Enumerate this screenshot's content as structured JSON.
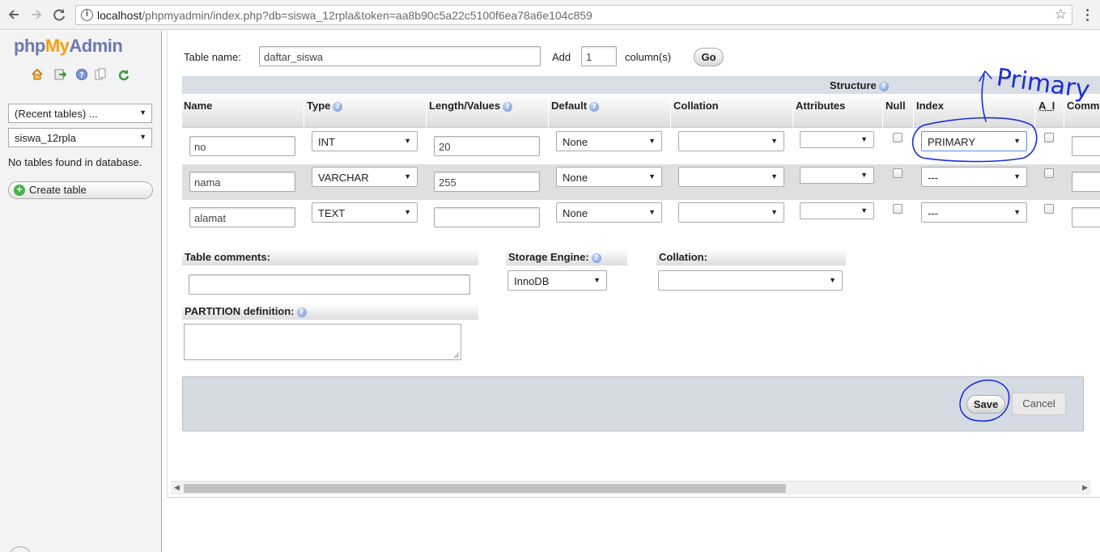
{
  "browser": {
    "url_host": "localhost",
    "url_path": "/phpmyadmin/index.php?db=siswa_12rpla&token=aa8b90c5a22c5100f6ea78a6e104c859"
  },
  "sidebar": {
    "logo_php": "php",
    "logo_my": "My",
    "logo_admin": "Admin",
    "recent_tables": "(Recent tables) ...",
    "database": "siswa_12rpla",
    "no_tables": "No tables found in database.",
    "create_table": "Create table",
    "icons": [
      "home-icon",
      "logout-icon",
      "help-icon",
      "docs-icon",
      "reload-icon"
    ]
  },
  "form": {
    "table_name_label": "Table name:",
    "table_name": "daftar_siswa",
    "add_label": "Add",
    "add_count": "1",
    "columns_label": "column(s)",
    "go": "Go",
    "structure_label": "Structure",
    "headers": {
      "name": "Name",
      "type": "Type",
      "length": "Length/Values",
      "default": "Default",
      "collation": "Collation",
      "attributes": "Attributes",
      "null": "Null",
      "index": "Index",
      "ai": "A_I",
      "comments": "Comm"
    },
    "rows": [
      {
        "name": "no",
        "type": "INT",
        "length": "20",
        "default": "None",
        "collation": "",
        "attributes": "",
        "index": "PRIMARY"
      },
      {
        "name": "nama",
        "type": "VARCHAR",
        "length": "255",
        "default": "None",
        "collation": "",
        "attributes": "",
        "index": "---"
      },
      {
        "name": "alamat",
        "type": "TEXT",
        "length": "",
        "default": "None",
        "collation": "",
        "attributes": "",
        "index": "---"
      }
    ],
    "table_comments_label": "Table comments:",
    "table_comments": "",
    "storage_engine_label": "Storage Engine:",
    "storage_engine": "InnoDB",
    "collation_label": "Collation:",
    "collation": "",
    "partition_label": "PARTITION definition:",
    "save": "Save",
    "cancel": "Cancel"
  },
  "annotation": {
    "handwritten_text": "Primary",
    "color": "#1a2fd6"
  }
}
